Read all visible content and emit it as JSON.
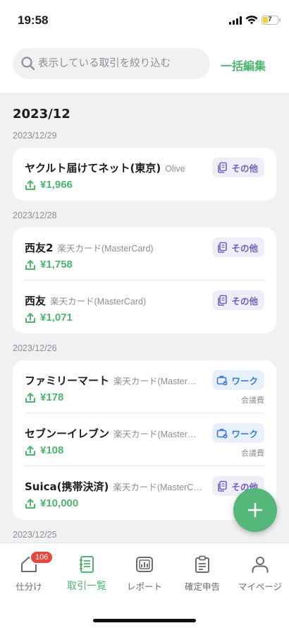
{
  "status_bar": {
    "time": "19:58",
    "battery_level": "7"
  },
  "search": {
    "placeholder": "表示している取引を絞り込む",
    "bulk_edit_label": "一括編集"
  },
  "month_header": "2023/12",
  "date_groups": [
    {
      "date": "2023/12/29",
      "transactions": [
        {
          "name": "ヤクルト届けてネット(東京)",
          "account": "Olive",
          "amount": "¥1,966",
          "tag": "その他",
          "tag_type": "other",
          "sub_tag": ""
        }
      ]
    },
    {
      "date": "2023/12/28",
      "transactions": [
        {
          "name": "西友2",
          "account": "楽天カード(MasterCard)",
          "amount": "¥1,758",
          "tag": "その他",
          "tag_type": "other",
          "sub_tag": ""
        },
        {
          "name": "西友",
          "account": "楽天カード(MasterCard)",
          "amount": "¥1,071",
          "tag": "その他",
          "tag_type": "other",
          "sub_tag": ""
        }
      ]
    },
    {
      "date": "2023/12/26",
      "transactions": [
        {
          "name": "ファミリーマート",
          "account": "楽天カード(Master…",
          "amount": "¥178",
          "tag": "ワーク",
          "tag_type": "work",
          "sub_tag": "会議費"
        },
        {
          "name": "セブンーイレブン",
          "account": "楽天カード(Master…",
          "amount": "¥108",
          "tag": "ワーク",
          "tag_type": "work",
          "sub_tag": "会議費"
        },
        {
          "name": "Suica(携帯決済)",
          "account": "楽天カード(MasterC…",
          "amount": "¥10,000",
          "tag": "その他",
          "tag_type": "other",
          "sub_tag": ""
        }
      ]
    },
    {
      "date": "2023/12/25",
      "transactions": []
    }
  ],
  "tabs": [
    {
      "label": "仕分け",
      "icon": "home-icon",
      "badge": "106"
    },
    {
      "label": "取引一覧",
      "icon": "notebook-icon",
      "active": true
    },
    {
      "label": "レポート",
      "icon": "report-chart-icon"
    },
    {
      "label": "確定申告",
      "icon": "clipboard-icon"
    },
    {
      "label": "マイページ",
      "icon": "person-icon"
    }
  ],
  "colors": {
    "accent_green": "#4cb56f",
    "other_tag": "#6f62c4",
    "work_tag": "#3a7bd5",
    "badge_red": "#e8453c"
  }
}
